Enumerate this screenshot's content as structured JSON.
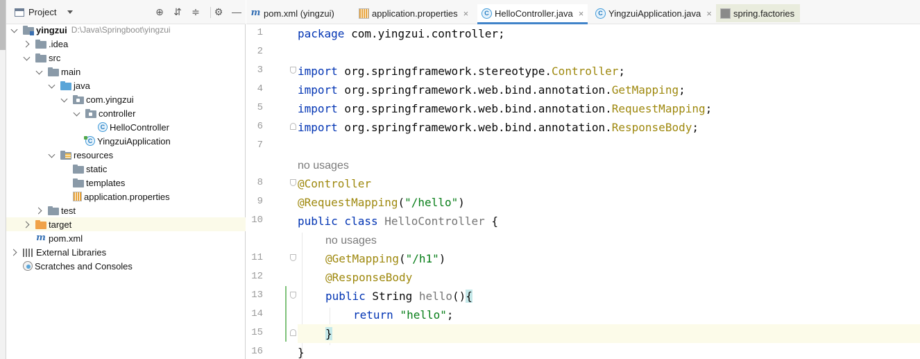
{
  "project_panel": {
    "title": "Project",
    "tree": [
      {
        "name": "yingzui",
        "path": "D:\\Java\\Springboot\\yingzui"
      },
      {
        "name": ".idea"
      },
      {
        "name": "src"
      },
      {
        "name": "main"
      },
      {
        "name": "java"
      },
      {
        "name": "com.yingzui"
      },
      {
        "name": "controller"
      },
      {
        "name": "HelloController"
      },
      {
        "name": "YingzuiApplication"
      },
      {
        "name": "resources"
      },
      {
        "name": "static"
      },
      {
        "name": "templates"
      },
      {
        "name": "application.properties"
      },
      {
        "name": "test"
      },
      {
        "name": "target"
      },
      {
        "name": "pom.xml"
      },
      {
        "name": "External Libraries"
      },
      {
        "name": "Scratches and Consoles"
      }
    ]
  },
  "tabs": [
    {
      "label": "pom.xml (yingzui)",
      "icon": "maven-icon"
    },
    {
      "label": "application.properties",
      "icon": "properties-file-icon"
    },
    {
      "label": "HelloController.java",
      "icon": "class-icon",
      "active": true
    },
    {
      "label": "YingzuiApplication.java",
      "icon": "class-icon"
    },
    {
      "label": "spring.factories",
      "icon": "file-icon"
    }
  ],
  "editor": {
    "line_numbers": [
      "1",
      "2",
      "3",
      "4",
      "5",
      "6",
      "7",
      "8",
      "9",
      "10",
      "11",
      "12",
      "13",
      "14",
      "15",
      "16"
    ],
    "lines": {
      "l1_kw": "package",
      "l1_rest": " com.yingzui.controller;",
      "l3_kw": "import",
      "l3_rest": " org.springframework.stereotype.",
      "l3_ann": "Controller",
      "l4_kw": "import",
      "l4_rest": " org.springframework.web.bind.annotation.",
      "l4_ann": "GetMapping",
      "l5_kw": "import",
      "l5_rest": " org.springframework.web.bind.annotation.",
      "l5_ann": "RequestMapping",
      "l6_kw": "import",
      "l6_rest": " org.springframework.web.bind.annotation.",
      "l6_ann": "ResponseBody",
      "hint1": "no usages",
      "l8_ann": "@Controller",
      "l9_ann": "@RequestMapping",
      "l9_open": "(",
      "l9_str": "\"/hello\"",
      "l9_close": ")",
      "l10_kw": "public class",
      "l10_name": " HelloController",
      "l10_brace": " {",
      "hint2": "no usages",
      "l11_ann": "@GetMapping",
      "l11_open": "(",
      "l11_str": "\"/h1\"",
      "l11_close": ")",
      "l12_ann": "@ResponseBody",
      "l13_kw": "public",
      "l13_type": " String ",
      "l13_name": "hello",
      "l13_paren": "()",
      "l13_brace": "{",
      "l14_kw": "return",
      "l14_str": " \"hello\"",
      "l14_semi": ";",
      "l15_brace": "}",
      "l16_brace": "}"
    }
  },
  "colors": {
    "keyword": "#0033b3",
    "annotation": "#9e880d",
    "string": "#067d17",
    "current_line": "#fcfbe9",
    "active_tab_underline": "#4083c9"
  }
}
